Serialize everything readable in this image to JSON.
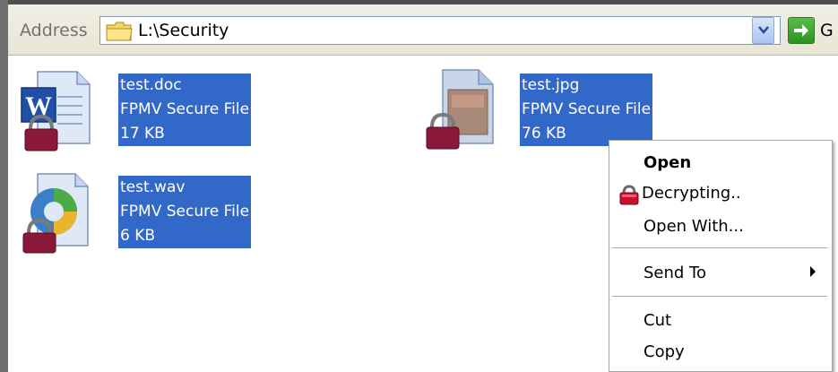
{
  "address_bar": {
    "label": "Address",
    "value": "L:\\Security",
    "go_label": "G"
  },
  "files": [
    {
      "name": "test.doc",
      "type": "FPMV Secure File",
      "size": "17 KB",
      "icon": "word-document-locked-icon"
    },
    {
      "name": "test.jpg",
      "type": "FPMV Secure File",
      "size": "76 KB",
      "icon": "image-file-locked-icon"
    },
    {
      "name": "test.wav",
      "type": "FPMV Secure File",
      "size": "6 KB",
      "icon": "audio-file-locked-icon"
    }
  ],
  "context_menu": {
    "items": [
      {
        "label": "Open",
        "bold": true
      },
      {
        "label": "Decrypting..",
        "icon": "lock-icon"
      },
      {
        "label": "Open With..."
      },
      {
        "label": "Send To",
        "submenu": true
      },
      {
        "label": "Cut"
      },
      {
        "label": "Copy"
      }
    ]
  },
  "colors": {
    "selection": "#3269c8",
    "lock": "#8a1838"
  }
}
